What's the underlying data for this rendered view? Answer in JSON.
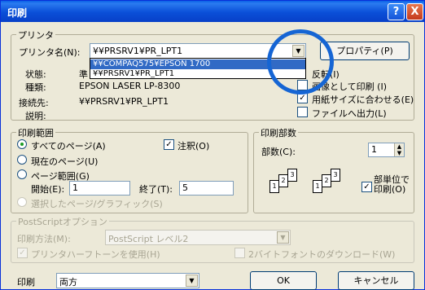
{
  "window": {
    "title": "印刷",
    "help_glyph": "?",
    "close_glyph": "X"
  },
  "printer": {
    "group_label": "プリンタ",
    "name_label": "プリンタ名(N):",
    "name_value": "¥¥PRSRV1¥PR_LPT1",
    "properties_button": "プロパティ(P)",
    "dropdown_items": [
      "¥¥COMPAQ575¥EPSON 1700",
      "¥¥PRSRV1¥PR_LPT1"
    ],
    "status_label": "状態:",
    "status_value": "準",
    "type_label": "種類:",
    "type_value": "EPSON LASER LP-8300",
    "connection_label": "接続先:",
    "connection_value": "¥¥PRSRV1¥PR_LPT1",
    "comment_label": "説明:",
    "options": [
      {
        "label": "反転(I)",
        "checked": false
      },
      {
        "label": "画像として印刷 (I)",
        "checked": false
      },
      {
        "label": "用紙サイズに合わせる(E)",
        "checked": true
      },
      {
        "label": "ファイルへ出力(L)",
        "checked": false
      }
    ]
  },
  "range": {
    "group_label": "印刷範囲",
    "all_pages": "すべてのページ(A)",
    "annotations": "注釈(O)",
    "current_page": "現在のページ(U)",
    "page_range": "ページ範囲(G)",
    "start_label": "開始(E):",
    "start_value": "1",
    "end_label": "終了(T):",
    "end_value": "5",
    "selected": "選択したページ/グラフィック(S)"
  },
  "copies": {
    "group_label": "印刷部数",
    "count_label": "部数(C):",
    "count_value": "1",
    "collate_label": "部単位で印刷(O)",
    "page_nums": [
      "1",
      "2",
      "3"
    ],
    "spin_up": "▲",
    "spin_down": "▼"
  },
  "postscript": {
    "group_label": "PostScriptオプション",
    "method_label": "印刷方法(M):",
    "method_value": "PostScript レベル2",
    "halftone": "プリンタハーフトーンを使用(H)",
    "download": "2バイトフォントのダウンロード(W)"
  },
  "footer": {
    "print_label": "印刷",
    "print_value": "両方",
    "ok": "OK",
    "cancel": "キャンセル"
  },
  "glyphs": {
    "dropdown_arrow": "▼",
    "check": "✓"
  },
  "colors": {
    "accent": "#1565D4",
    "titlebar": "#0A4FD8",
    "selection": "#316AC5"
  }
}
